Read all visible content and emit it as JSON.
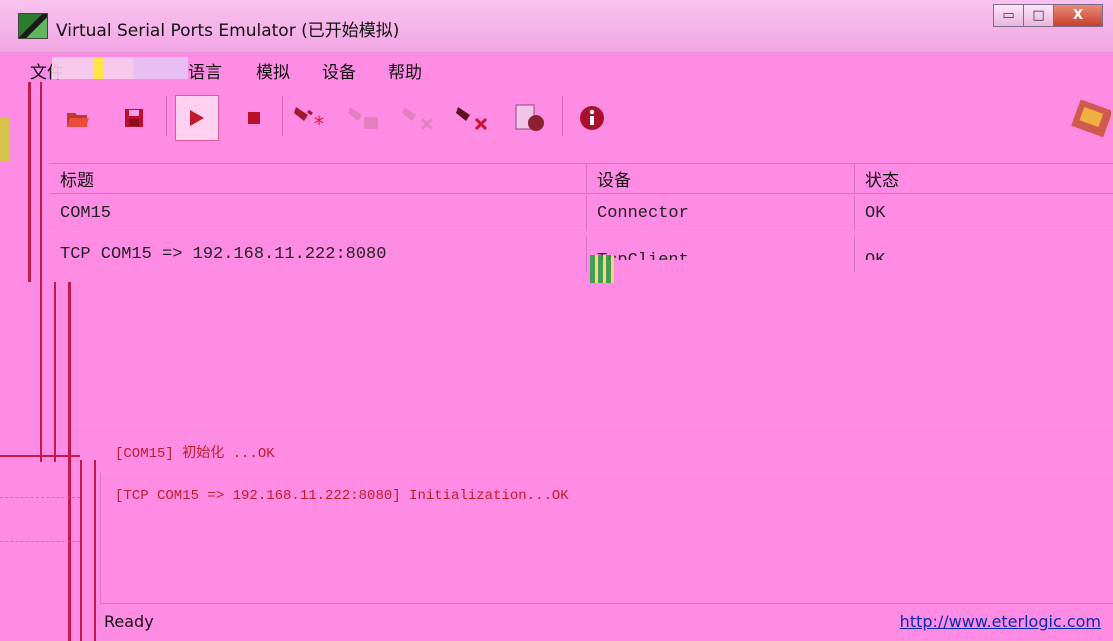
{
  "window": {
    "title": "Virtual Serial Ports Emulator (已开始模拟)",
    "minimize_glyph": "▭",
    "maximize_glyph": "□",
    "close_glyph": "X"
  },
  "menu": {
    "items": [
      {
        "label": "文件"
      },
      {
        "label": "语言"
      },
      {
        "label": "模拟"
      },
      {
        "label": "设备"
      },
      {
        "label": "帮助"
      }
    ]
  },
  "toolbar": {
    "icons": [
      "open-folder-icon",
      "save-icon",
      "play-icon",
      "stop-icon",
      "new-device-icon",
      "edit-device-icon",
      "disconnect-device-icon",
      "delete-device-icon",
      "settings-icon",
      "info-icon"
    ]
  },
  "device_table": {
    "columns": [
      "标题",
      "设备",
      "状态"
    ],
    "rows": [
      {
        "title": "COM15",
        "device": "Connector",
        "status": "OK"
      },
      {
        "title": "TCP COM15 => 192.168.11.222:8080",
        "device": "TcpClient",
        "status": "OK"
      }
    ]
  },
  "log": {
    "lines": [
      "[COM15] 初始化  ...OK",
      "[TCP COM15 => 192.168.11.222:8080] Initialization...OK"
    ]
  },
  "status": {
    "text": "Ready",
    "link": "http://www.eterlogic.com"
  },
  "colors": {
    "background": "#ff8ce4",
    "log_text": "#c01a2c",
    "link": "#0a2ca8"
  }
}
